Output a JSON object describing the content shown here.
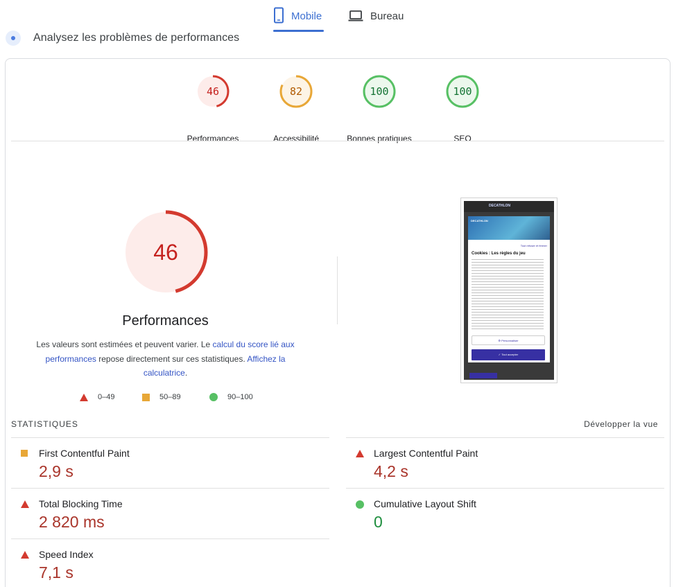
{
  "tabs": [
    {
      "label": "Mobile",
      "icon": "smartphone-icon",
      "active": true
    },
    {
      "label": "Bureau",
      "icon": "laptop-icon",
      "active": false
    }
  ],
  "header": {
    "title": "Analysez les problèmes de performances"
  },
  "scores": [
    {
      "label": "Performances",
      "value": "46",
      "fraction": 0.46,
      "color": "#d33a2f",
      "fill": "#fdecea"
    },
    {
      "label": "Accessibilité",
      "value": "82",
      "fraction": 0.82,
      "color": "#e8a737",
      "fill": "#fdf4e6"
    },
    {
      "label": "Bonnes pratiques",
      "value": "100",
      "fraction": 1.0,
      "color": "#57c064",
      "fill": "#ecf8ed"
    },
    {
      "label": "SEO",
      "value": "100",
      "fraction": 1.0,
      "color": "#57c064",
      "fill": "#ecf8ed"
    }
  ],
  "main": {
    "score": "46",
    "fraction": 0.46,
    "title": "Performances",
    "desc_1": "Les valeurs sont estimées et peuvent varier. Le ",
    "link_1": "calcul du score lié aux performances",
    "desc_2": " repose directement sur ces statistiques. ",
    "link_2": "Affichez la calculatrice",
    "desc_3": "."
  },
  "legend": [
    {
      "shape": "triangle",
      "label": "0–49",
      "color": "#d33a2f"
    },
    {
      "shape": "square",
      "label": "50–89",
      "color": "#e8a737"
    },
    {
      "shape": "circle",
      "label": "90–100",
      "color": "#57c064"
    }
  ],
  "phone": {
    "brand": "DECATHLON",
    "refuse": "Tout refuser et fermer",
    "cookie_title": "Cookies : Les règles du jeu",
    "customize": "⚙ Personnaliser",
    "accept": "✓ Tout accepter"
  },
  "stats": {
    "title": "STATISTIQUES",
    "expand": "Développer la vue",
    "metrics": [
      {
        "name": "First Contentful Paint",
        "value": "2,9 s",
        "status": "average"
      },
      {
        "name": "Largest Contentful Paint",
        "value": "4,2 s",
        "status": "fail"
      },
      {
        "name": "Total Blocking Time",
        "value": "2 820 ms",
        "status": "fail"
      },
      {
        "name": "Cumulative Layout Shift",
        "value": "0",
        "status": "pass"
      },
      {
        "name": "Speed Index",
        "value": "7,1 s",
        "status": "fail"
      }
    ]
  }
}
